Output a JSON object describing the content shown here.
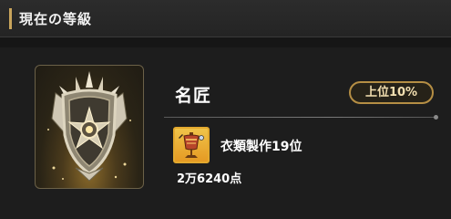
{
  "header": {
    "title": "現在の等級"
  },
  "rank": {
    "name": "名匠",
    "badge": "上位10%"
  },
  "achievement": {
    "icon": "tailoring-mannequin-icon",
    "label": "衣類製作19位",
    "score": "2万6240点"
  },
  "colors": {
    "accent": "#c9a55c",
    "badge_border": "#b58e44",
    "icon_bg": "#e9a42c"
  }
}
